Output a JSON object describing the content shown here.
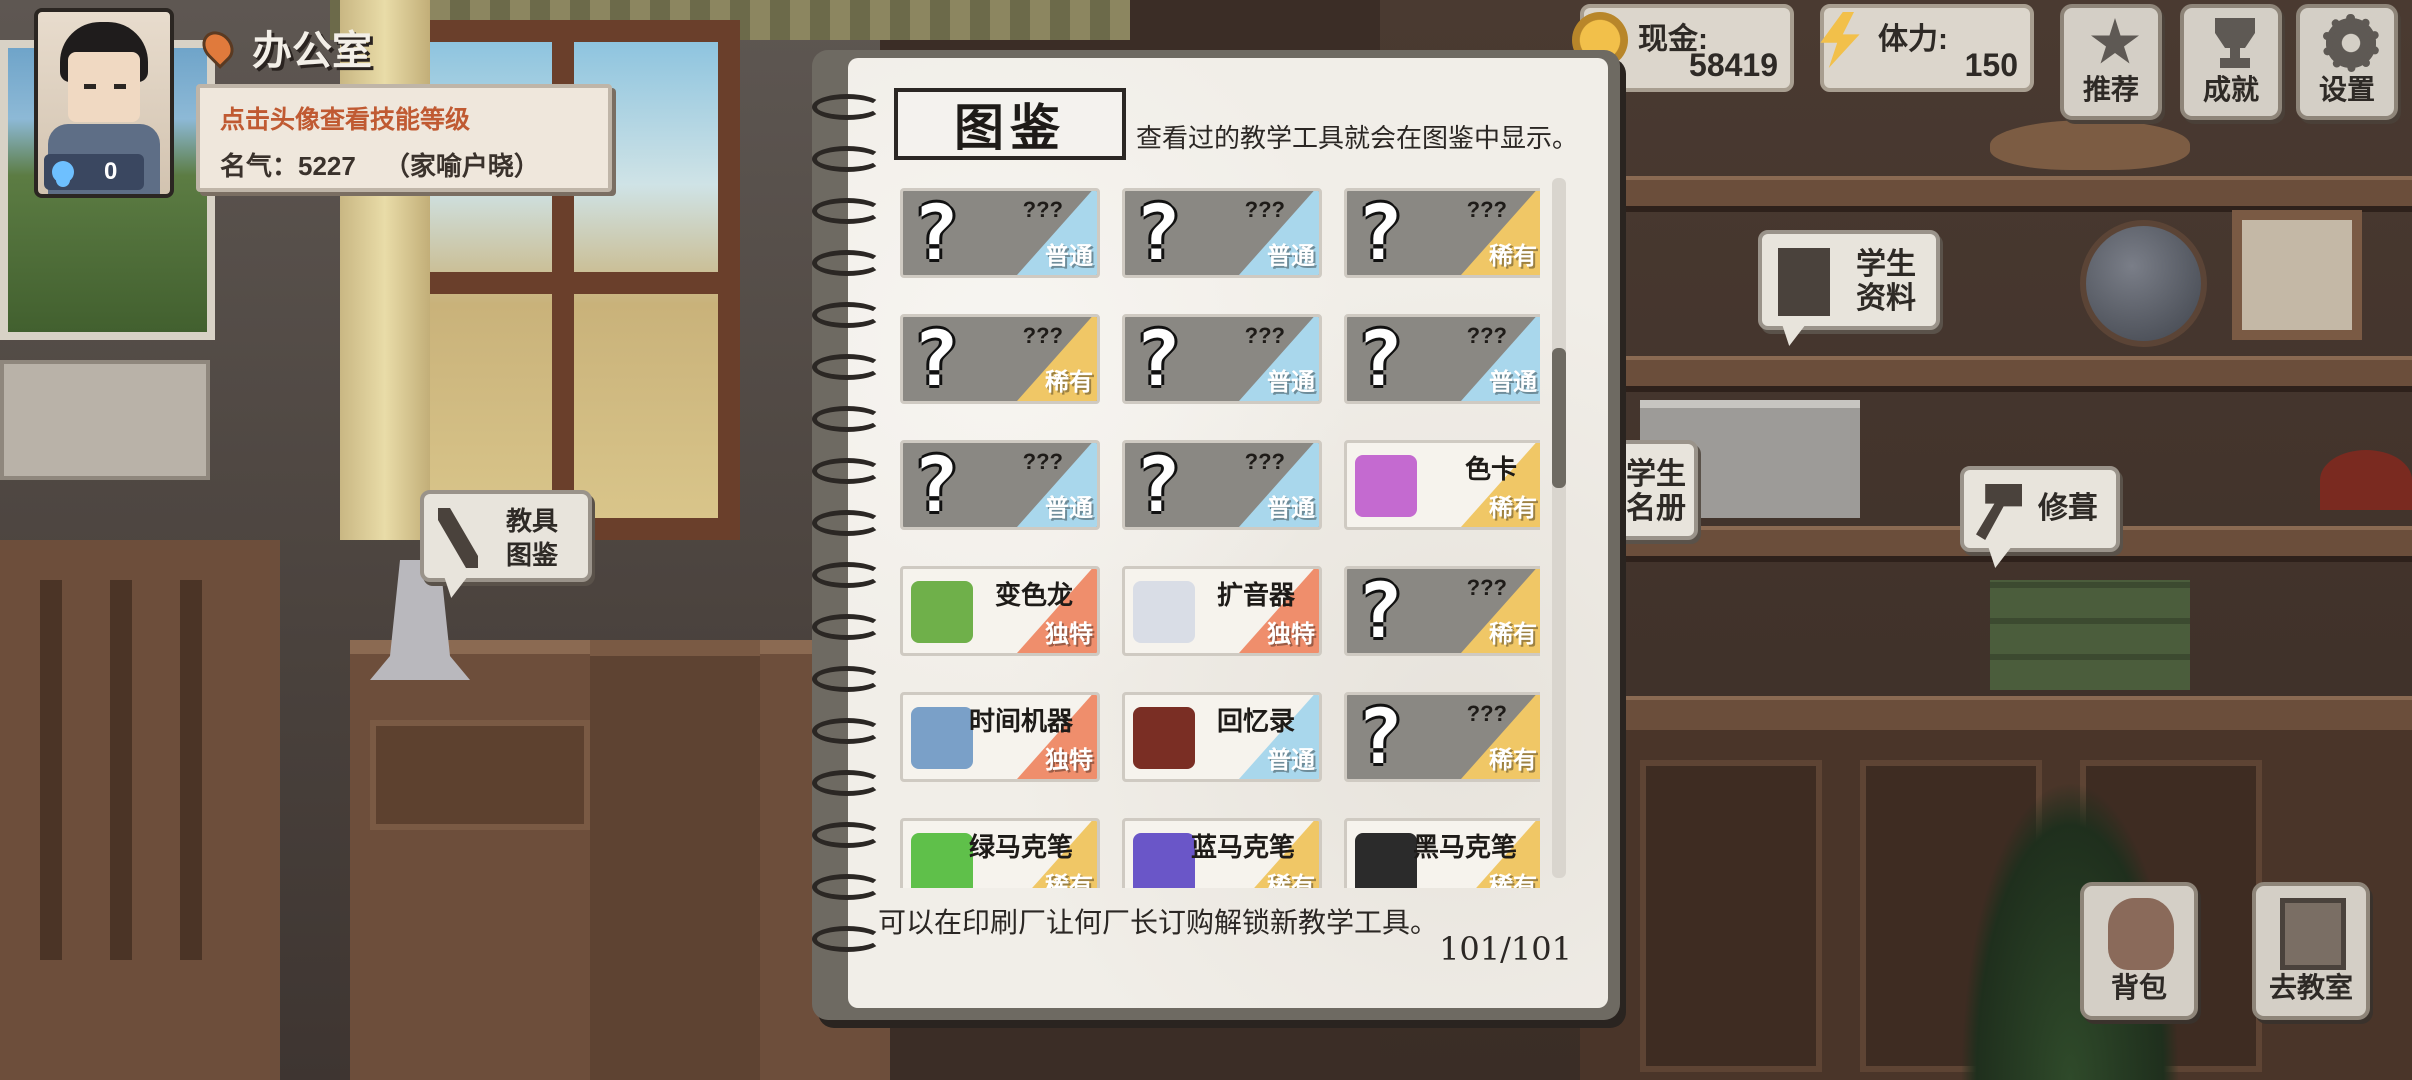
{
  "location": {
    "title": "办公室"
  },
  "profile": {
    "hint": "点击头像查看技能等级",
    "fame_label": "名气：",
    "fame_value": "5227",
    "fame_title": "（家喻户晓）",
    "skill_points": "0"
  },
  "hud": {
    "cash_label": "现金:",
    "cash_value": "58419",
    "stamina_label": "体力:",
    "stamina_value": "150",
    "buttons": [
      {
        "label": "推荐",
        "icon": "star-icon"
      },
      {
        "label": "成就",
        "icon": "trophy-icon"
      },
      {
        "label": "设置",
        "icon": "gear-icon"
      }
    ]
  },
  "scene_bubbles": {
    "tools_catalog": [
      "教具",
      "图鉴"
    ],
    "student_profile": [
      "学生",
      "资料"
    ],
    "student_roster": [
      "学生",
      "名册"
    ],
    "repair": "修葺"
  },
  "notebook": {
    "title": "图鉴",
    "subtitle": "查看过的教学工具就会在图鉴中显示。",
    "tip": "可以在印刷厂让何厂长订购解锁新教学工具。",
    "count": "101/101",
    "items": [
      {
        "name": "???",
        "rarity": "普通",
        "locked": true
      },
      {
        "name": "???",
        "rarity": "普通",
        "locked": true
      },
      {
        "name": "???",
        "rarity": "稀有",
        "locked": true
      },
      {
        "name": "???",
        "rarity": "稀有",
        "locked": true
      },
      {
        "name": "???",
        "rarity": "普通",
        "locked": true
      },
      {
        "name": "???",
        "rarity": "普通",
        "locked": true
      },
      {
        "name": "???",
        "rarity": "普通",
        "locked": true
      },
      {
        "name": "???",
        "rarity": "普通",
        "locked": true
      },
      {
        "name": "色卡",
        "rarity": "稀有",
        "locked": false,
        "icon": "color-card-icon"
      },
      {
        "name": "变色龙",
        "rarity": "独特",
        "locked": false,
        "icon": "chameleon-icon"
      },
      {
        "name": "扩音器",
        "rarity": "独特",
        "locked": false,
        "icon": "megaphone-icon"
      },
      {
        "name": "???",
        "rarity": "稀有",
        "locked": true
      },
      {
        "name": "时间机器",
        "rarity": "独特",
        "locked": false,
        "icon": "time-machine-icon"
      },
      {
        "name": "回忆录",
        "rarity": "普通",
        "locked": false,
        "icon": "memoir-book-icon"
      },
      {
        "name": "???",
        "rarity": "稀有",
        "locked": true
      },
      {
        "name": "绿马克笔",
        "rarity": "稀有",
        "locked": false,
        "icon": "green-marker-icon"
      },
      {
        "name": "蓝马克笔",
        "rarity": "稀有",
        "locked": false,
        "icon": "blue-marker-icon"
      },
      {
        "name": "黑马克笔",
        "rarity": "稀有",
        "locked": false,
        "icon": "black-marker-icon"
      }
    ]
  },
  "rarity_colors": {
    "普通": "#a9d7ec",
    "稀有": "#f0c766",
    "独特": "#ef8e6c"
  },
  "item_icon_colors": {
    "color-card-icon": "#c46ad0",
    "chameleon-icon": "#6fb04a",
    "megaphone-icon": "#d9dde6",
    "time-machine-icon": "#7aa0c8",
    "memoir-book-icon": "#7a2e24",
    "green-marker-icon": "#5fc04a",
    "blue-marker-icon": "#6a56c8",
    "black-marker-icon": "#2b2b2b"
  },
  "bottom_buttons": [
    {
      "label": "背包",
      "icon": "bag-icon"
    },
    {
      "label": "去教室",
      "icon": "door-icon"
    }
  ]
}
